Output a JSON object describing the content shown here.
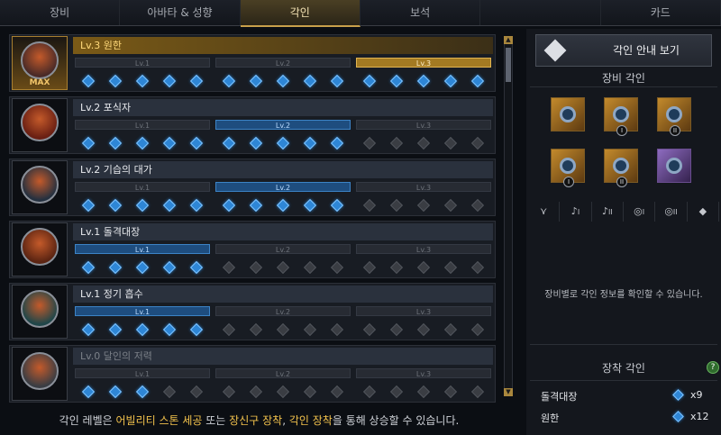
{
  "tabs": [
    {
      "label": "장비",
      "active": false
    },
    {
      "label": "아바타 & 성향",
      "active": false
    },
    {
      "label": "각인",
      "active": true
    },
    {
      "label": "보석",
      "active": false
    },
    {
      "label": "",
      "active": false
    },
    {
      "label": "카드",
      "active": false
    }
  ],
  "engravings": [
    {
      "title": "Lv.3 원한",
      "active_level": 3,
      "style": "gold",
      "max_label": "MAX",
      "gems_filled": 15
    },
    {
      "title": "Lv.2 포식자",
      "active_level": 2,
      "style": "normal",
      "max_label": "",
      "gems_filled": 10
    },
    {
      "title": "Lv.2 기습의 대가",
      "active_level": 2,
      "style": "normal",
      "max_label": "",
      "gems_filled": 10
    },
    {
      "title": "Lv.1 돌격대장",
      "active_level": 1,
      "style": "normal",
      "max_label": "",
      "gems_filled": 5
    },
    {
      "title": "Lv.1 정기 흡수",
      "active_level": 1,
      "style": "normal",
      "max_label": "",
      "gems_filled": 5
    },
    {
      "title": "Lv.0 달인의 저력",
      "active_level": 0,
      "style": "dim",
      "max_label": "",
      "gems_filled": 3
    }
  ],
  "level_labels": [
    "Lv.1",
    "Lv.2",
    "Lv.3"
  ],
  "footer": {
    "prefix": "각인 레벨은 ",
    "hl1": "어빌리티 스톤 세공",
    "mid1": " 또는 ",
    "hl2": "장신구 장착",
    "mid2": ", ",
    "hl3": "각인 장착",
    "suffix": "을 통해 상승할 수 있습니다."
  },
  "right_panel": {
    "guide_button": "각인 안내 보기",
    "equip_section_title": "장비 각인",
    "slots": [
      {
        "icon": "necklace-icon",
        "badge": "",
        "color": "orange"
      },
      {
        "icon": "earring-icon",
        "badge": "I",
        "color": "orange"
      },
      {
        "icon": "earring-icon",
        "badge": "II",
        "color": "orange"
      },
      {
        "icon": "ring-icon",
        "badge": "I",
        "color": "orange"
      },
      {
        "icon": "ring-icon",
        "badge": "II",
        "color": "orange"
      },
      {
        "icon": "ability-stone-icon",
        "badge": "",
        "color": "purple"
      }
    ],
    "filters": [
      "",
      "I",
      "II",
      "I",
      "II",
      ""
    ],
    "info": "장비별로 각인 정보를 확인할 수 있습니다.",
    "help": "?",
    "equipped_section_title": "장착 각인",
    "equipped": [
      {
        "name": "돌격대장",
        "count": "x9"
      },
      {
        "name": "원한",
        "count": "x12"
      }
    ]
  }
}
